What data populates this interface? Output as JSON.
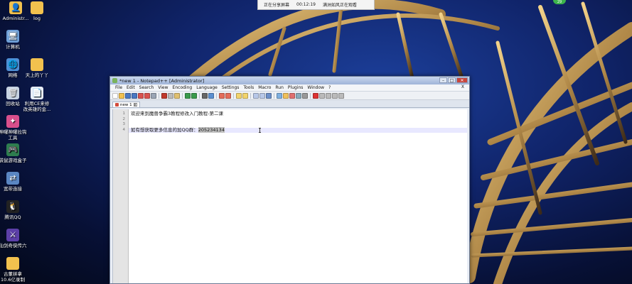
{
  "share_bar": {
    "status": "正在分享屏幕",
    "timer": "00:12:19",
    "viewer_note": "满洲如风正在观看"
  },
  "user_badge": "29",
  "desktop_icons": [
    {
      "label": "Administr...",
      "icon": "folder-user-icon"
    },
    {
      "label": "log",
      "icon": "folder-icon"
    },
    {
      "label": "计算机",
      "icon": "computer-icon"
    },
    {
      "label": "网络",
      "icon": "network-icon"
    },
    {
      "label": "天上的丫丫",
      "icon": "folder-icon"
    },
    {
      "label": "回收站",
      "icon": "recycle-bin-icon"
    },
    {
      "label": "利用CE来修",
      "icon": "document-icon"
    },
    {
      "label": "改英雄的金...",
      "icon": "document-icon"
    },
    {
      "label": "神曜神曜拉钩",
      "icon": "app-icon"
    },
    {
      "label": "工具",
      "icon": "app-icon"
    },
    {
      "label": "袋鼠游戏盒子",
      "icon": "game-box-icon"
    },
    {
      "label": "宽带连接",
      "icon": "broadband-icon"
    },
    {
      "label": "腾讯QQ",
      "icon": "qq-icon"
    },
    {
      "label": "仙剑奇侠传六",
      "icon": "game-icon"
    },
    {
      "label": "古董拼拿",
      "icon": "folder-icon"
    },
    {
      "label": "10.6亿录制",
      "icon": "folder-icon"
    }
  ],
  "window": {
    "title": "*new 1 - Notepad++ [Administrator]",
    "menu": [
      "File",
      "Edit",
      "Search",
      "View",
      "Encoding",
      "Language",
      "Settings",
      "Tools",
      "Macro",
      "Run",
      "Plugins",
      "Window",
      "?"
    ],
    "menu_close": "X",
    "tab_label": "new 1",
    "editor_lines": [
      {
        "num": "1",
        "text": "欢迎来到魔兽争霸3教程修改入门教程-第二课",
        "highlight": ""
      },
      {
        "num": "2",
        "text": "",
        "highlight": ""
      },
      {
        "num": "3",
        "text": "",
        "highlight": ""
      },
      {
        "num": "4",
        "text": "如有想获取更多信息的加QQ群：",
        "highlight": "205234134"
      }
    ]
  },
  "colors": {
    "title_bar": "#9fb4d8",
    "close_button": "#c9463d",
    "current_line": "#e8e8ff"
  }
}
